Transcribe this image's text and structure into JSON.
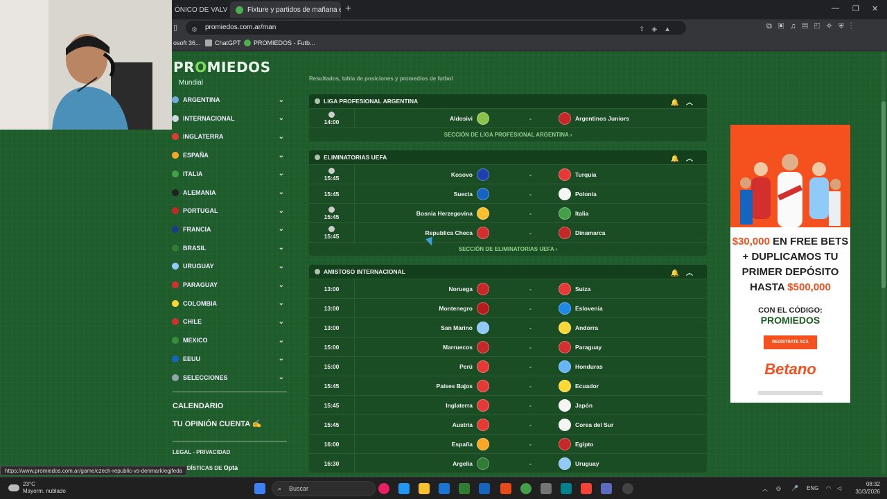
{
  "browser": {
    "tab_inactive": "ÓNICO DE VALVERD",
    "tab_active": "Fixture y partidos de mañana en",
    "url": "promiedos.com.ar/man",
    "bookmarks": [
      "osoft 36...",
      "ChatGPT",
      "PROMIEDOS - Futb..."
    ]
  },
  "site": {
    "logo": "PROMIEDOS",
    "mundial": "Mundial",
    "subtitle": "Resultados, tabla de posiciones y promedios de futbol",
    "countries": [
      {
        "label": "ARGENTINA",
        "color": "#74acdf"
      },
      {
        "label": "INTERNACIONAL",
        "color": "#cfd8dc"
      },
      {
        "label": "INGLATERRA",
        "color": "#e53935"
      },
      {
        "label": "ESPAÑA",
        "color": "#f9a825"
      },
      {
        "label": "ITALIA",
        "color": "#43a047"
      },
      {
        "label": "ALEMANIA",
        "color": "#212121"
      },
      {
        "label": "PORTUGAL",
        "color": "#c62828"
      },
      {
        "label": "FRANCIA",
        "color": "#1e3a8a"
      },
      {
        "label": "BRASIL",
        "color": "#2e7d32"
      },
      {
        "label": "URUGUAY",
        "color": "#90caf9"
      },
      {
        "label": "PARAGUAY",
        "color": "#d32f2f"
      },
      {
        "label": "COLOMBIA",
        "color": "#fdd835"
      },
      {
        "label": "CHILE",
        "color": "#d32f2f"
      },
      {
        "label": "MEXICO",
        "color": "#388e3c"
      },
      {
        "label": "EEUU",
        "color": "#1565c0"
      },
      {
        "label": "SELECCIONES",
        "color": "#90a4ae"
      }
    ],
    "calendario": "CALENDARIO",
    "opinion": "TU OPINIÓN CUENTA ✍️",
    "legal": "LEGAL  -  PRIVACIDAD",
    "estadisticas": "ESTADÍSTICAS DE",
    "opta": "Opta"
  },
  "leagues": [
    {
      "name": "LIGA PROFESIONAL ARGENTINA",
      "section": "SECCIÓN DE LIGA PROFESIONAL ARGENTINA ›",
      "matches": [
        {
          "time": "14:00",
          "tv": true,
          "home": "Aldosivi",
          "away": "Argentinos Juniors",
          "hc": "#8bc34a",
          "ac": "#c62828"
        }
      ]
    },
    {
      "name": "ELIMINATORIAS UEFA",
      "section": "SECCIÓN DE ELIMINATORIAS UEFA ›",
      "matches": [
        {
          "time": "15:45",
          "tv": true,
          "home": "Kosovo",
          "away": "Turquía",
          "hc": "#1e40af",
          "ac": "#e53935"
        },
        {
          "time": "15:45",
          "tv": false,
          "home": "Suecia",
          "away": "Polonia",
          "hc": "#1565c0",
          "ac": "#f5f5f5"
        },
        {
          "time": "15:45",
          "tv": true,
          "home": "Bosnia Herzegovina",
          "away": "Italia",
          "hc": "#fbc02d",
          "ac": "#43a047"
        },
        {
          "time": "15:45",
          "tv": true,
          "home": "Republica Checa",
          "away": "Dinamarca",
          "hc": "#d32f2f",
          "ac": "#c62828"
        }
      ]
    },
    {
      "name": "AMISTOSO INTERNACIONAL",
      "section": "",
      "matches": [
        {
          "time": "13:00",
          "tv": false,
          "home": "Noruega",
          "away": "Suiza",
          "hc": "#c62828",
          "ac": "#e53935"
        },
        {
          "time": "13:00",
          "tv": false,
          "home": "Montenegro",
          "away": "Eslovenia",
          "hc": "#b71c1c",
          "ac": "#1e88e5"
        },
        {
          "time": "13:00",
          "tv": false,
          "home": "San Marino",
          "away": "Andorra",
          "hc": "#90caf9",
          "ac": "#fdd835"
        },
        {
          "time": "15:00",
          "tv": false,
          "home": "Marruecos",
          "away": "Paraguay",
          "hc": "#c62828",
          "ac": "#d32f2f"
        },
        {
          "time": "15:00",
          "tv": false,
          "home": "Perú",
          "away": "Honduras",
          "hc": "#e53935",
          "ac": "#64b5f6"
        },
        {
          "time": "15:45",
          "tv": false,
          "home": "Países Bajos",
          "away": "Ecuador",
          "hc": "#e53935",
          "ac": "#fdd835"
        },
        {
          "time": "15:45",
          "tv": false,
          "home": "Inglaterra",
          "away": "Japón",
          "hc": "#e53935",
          "ac": "#f5f5f5"
        },
        {
          "time": "15:45",
          "tv": false,
          "home": "Austria",
          "away": "Corea del Sur",
          "hc": "#e53935",
          "ac": "#f5f5f5"
        },
        {
          "time": "16:00",
          "tv": false,
          "home": "España",
          "away": "Egipto",
          "hc": "#f9a825",
          "ac": "#c62828"
        },
        {
          "time": "16:30",
          "tv": false,
          "home": "Argelia",
          "away": "Uruguay",
          "hc": "#2e7d32",
          "ac": "#90caf9"
        }
      ]
    }
  ],
  "ad": {
    "line1a": "$30,000",
    "line1b": " EN FREE BETS",
    "line2": "+ DUPLICAMOS TU",
    "line3": "PRIMER DEPÓSITO",
    "line4a": "HASTA ",
    "line4b": "$500,000",
    "code": "CON EL CÓDIGO:",
    "promi": "PROMIEDOS",
    "button": "REGÍSTRATE ACÁ",
    "brand": "Betano"
  },
  "status_url": "https://www.promiedos.com.ar/game/czech-republic-vs-denmark/egjfeda",
  "taskbar": {
    "temp": "23°C",
    "weather": "Mayorm. nublado",
    "search": "Buscar",
    "lang": "ENG",
    "time": "08:32",
    "date": "30/3/2026"
  }
}
